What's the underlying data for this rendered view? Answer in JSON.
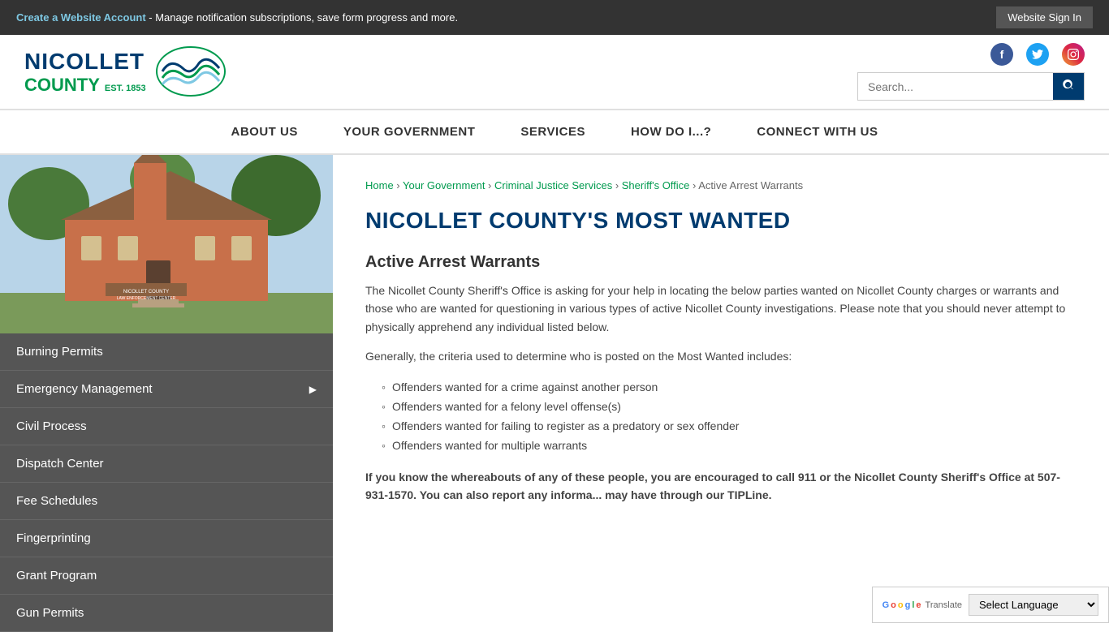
{
  "topbar": {
    "create_account_link": "Create a Website Account",
    "manage_text": " - Manage notification subscriptions, save form progress and more.",
    "sign_in_label": "Website Sign In"
  },
  "header": {
    "logo": {
      "nicollet": "NICOLLET",
      "county": "COUNTY",
      "est": "EST. 1853"
    },
    "search": {
      "placeholder": "Search..."
    }
  },
  "nav": {
    "items": [
      {
        "label": "ABOUT US",
        "href": "#"
      },
      {
        "label": "YOUR GOVERNMENT",
        "href": "#"
      },
      {
        "label": "SERVICES",
        "href": "#"
      },
      {
        "label": "HOW DO I...?",
        "href": "#"
      },
      {
        "label": "CONNECT WITH US",
        "href": "#"
      }
    ]
  },
  "sidebar": {
    "menu_items": [
      {
        "label": "Burning Permits",
        "has_arrow": false
      },
      {
        "label": "Emergency Management",
        "has_arrow": true
      },
      {
        "label": "Civil Process",
        "has_arrow": false
      },
      {
        "label": "Dispatch Center",
        "has_arrow": false
      },
      {
        "label": "Fee Schedules",
        "has_arrow": false
      },
      {
        "label": "Fingerprinting",
        "has_arrow": false
      },
      {
        "label": "Grant Program",
        "has_arrow": false
      },
      {
        "label": "Gun Permits",
        "has_arrow": false
      }
    ]
  },
  "breadcrumb": {
    "items": [
      {
        "label": "Home",
        "href": "#"
      },
      {
        "label": "Your Government",
        "href": "#"
      },
      {
        "label": "Criminal Justice Services",
        "href": "#"
      },
      {
        "label": "Sheriff's Office",
        "href": "#"
      },
      {
        "label": "Active Arrest Warrants",
        "href": null
      }
    ]
  },
  "content": {
    "page_title": "NICOLLET COUNTY'S MOST WANTED",
    "section_title": "Active Arrest Warrants",
    "intro_text": "The Nicollet County Sheriff's Office is asking for your help in locating the below parties wanted on Nicollet County charges or warrants and those who are wanted for questioning in various types of active Nicollet County investigations. Please note that you should never attempt to physically apprehend any individual listed below.",
    "criteria_intro": "Generally, the criteria used to determine who is posted on the Most Wanted includes:",
    "criteria": [
      "Offenders wanted for a crime against another person",
      "Offenders wanted for a felony level offense(s)",
      "Offenders wanted for failing to register as a predatory or sex offender",
      "Offenders wanted for multiple warrants"
    ],
    "call_to_action": "If you know the whereabouts of any of these people, you are encouraged to call 911 or the Nicollet County Sheriff's Office at 507-931-1570. You can also report any informa... may have through our TIPLine."
  },
  "translate": {
    "label": "Select Language",
    "google_text": "Google",
    "translate_text": "Translate"
  }
}
